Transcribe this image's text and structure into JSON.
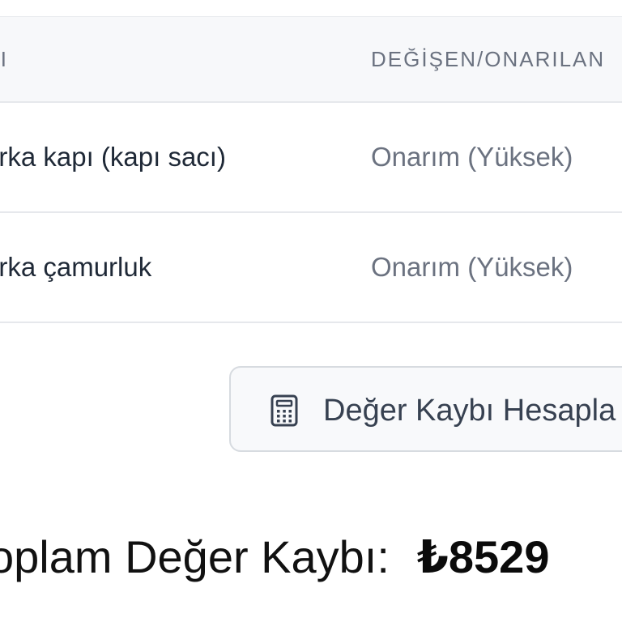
{
  "table": {
    "headers": [
      "DI",
      "DEĞİŞEN/ONARILAN"
    ],
    "rows": [
      {
        "part": "arka kapı (kapı sacı)",
        "status": "Onarım (Yüksek)"
      },
      {
        "part": "arka çamurluk",
        "status": "Onarım (Yüksek)"
      }
    ]
  },
  "actions": {
    "calculate_label": "Değer Kaybı Hesapla",
    "calculate_icon": "calculator-icon"
  },
  "summary": {
    "total_label": "oplam Değer Kaybı:",
    "total_value": "₺8529"
  },
  "colors": {
    "header_bg": "#f7f8fa",
    "border": "#e6e8ec",
    "muted_text": "#6b7280",
    "primary_text": "#1f2937"
  }
}
